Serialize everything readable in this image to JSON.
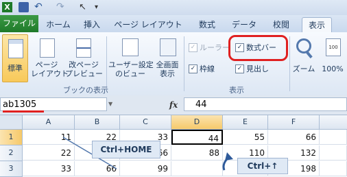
{
  "tabs": {
    "file": "ファイル",
    "items": [
      "ホーム",
      "挿入",
      "ページ レイアウト",
      "数式",
      "データ",
      "校閲",
      "表示"
    ]
  },
  "ribbon": {
    "normal": "標準",
    "page_layout": "ページ\nレイアウト",
    "page_break": "改ページ\nプレビュー",
    "custom_view": "ユーザー設定\nのビュー",
    "full_screen": "全画面\n表示",
    "group_book": "ブックの表示",
    "ruler": "ルーラー",
    "formula_bar": "数式バー",
    "gridlines": "枠線",
    "headings": "見出し",
    "group_show": "表示",
    "zoom": "ズーム",
    "zoom100": "100%"
  },
  "formula_bar": {
    "name_box": "ab1305",
    "fx": "fx",
    "value": "44"
  },
  "grid": {
    "columns": [
      "A",
      "B",
      "C",
      "D",
      "E",
      "F"
    ],
    "rows": [
      "1",
      "2",
      "3"
    ],
    "cells": [
      [
        "11",
        "22",
        "33",
        "44",
        "55",
        "66"
      ],
      [
        "22",
        "",
        "66",
        "88",
        "110",
        "132"
      ],
      [
        "33",
        "66",
        "99",
        "",
        "",
        "198"
      ]
    ]
  },
  "callouts": {
    "ctrl_home": "Ctrl+HOME",
    "ctrl_up": "Ctrl+↑"
  },
  "colors": {
    "file_tab": "#1f7a2a",
    "highlight_red": "#e02020",
    "selected_header": "#f9d99a"
  }
}
